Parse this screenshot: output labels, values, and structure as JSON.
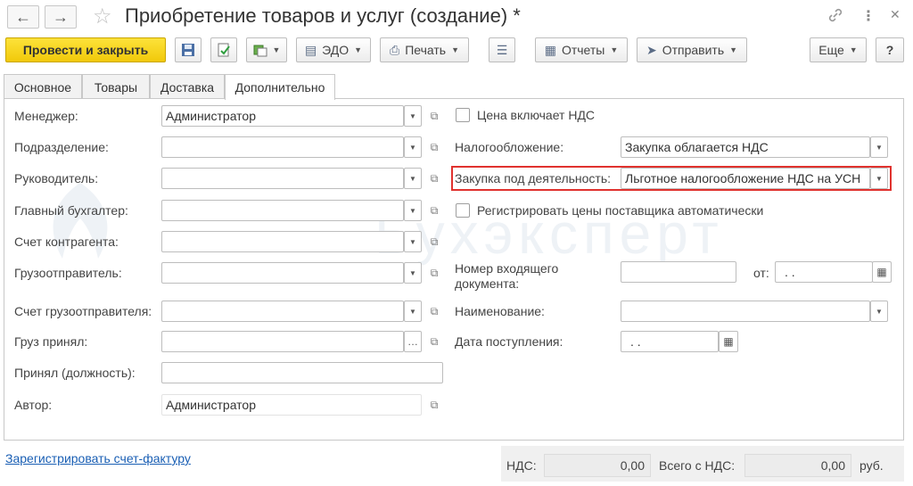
{
  "window": {
    "title": "Приобретение товаров и услуг (создание) *"
  },
  "toolbar": {
    "post_close": "Провести и закрыть",
    "edo": "ЭДО",
    "print": "Печать",
    "reports": "Отчеты",
    "send": "Отправить",
    "more": "Еще",
    "help": "?"
  },
  "tabs": [
    "Основное",
    "Товары",
    "Доставка",
    "Дополнительно"
  ],
  "left": {
    "manager_label": "Менеджер:",
    "manager_value": "Администратор",
    "division_label": "Подразделение:",
    "head_label": "Руководитель:",
    "chief_acc_label": "Главный бухгалтер:",
    "contractor_acc_label": "Счет контрагента:",
    "shipper_label": "Грузоотправитель:",
    "shipper_acc_label": "Счет грузоотправителя:",
    "received_label": "Груз принял:",
    "received_pos_label": "Принял (должность):",
    "author_label": "Автор:",
    "author_value": "Администратор"
  },
  "right": {
    "vat_included_label": "Цена включает НДС",
    "taxation_label": "Налогообложение:",
    "taxation_value": "Закупка облагается НДС",
    "activity_label": "Закупка под деятельность:",
    "activity_value": "Льготное налогообложение НДС на УСН",
    "register_prices_label": "Регистрировать цены поставщика автоматически",
    "incoming_num_label_1": "Номер входящего",
    "incoming_num_label_2": "документа:",
    "from_label": "от:",
    "from_value": ". .",
    "name_label": "Наименование:",
    "receipt_date_label": "Дата поступления:",
    "receipt_date_value": ". ."
  },
  "footer": {
    "register_invoice": "Зарегистрировать счет-фактуру",
    "vat_label": "НДС:",
    "vat_value": "0,00",
    "total_label": "Всего с НДС:",
    "total_value": "0,00",
    "currency": "руб."
  },
  "watermark": "Бухэксперт",
  "colors": {
    "primary_button": "#f5d215",
    "highlight_border": "#e0322e",
    "link": "#1a5fb4"
  }
}
